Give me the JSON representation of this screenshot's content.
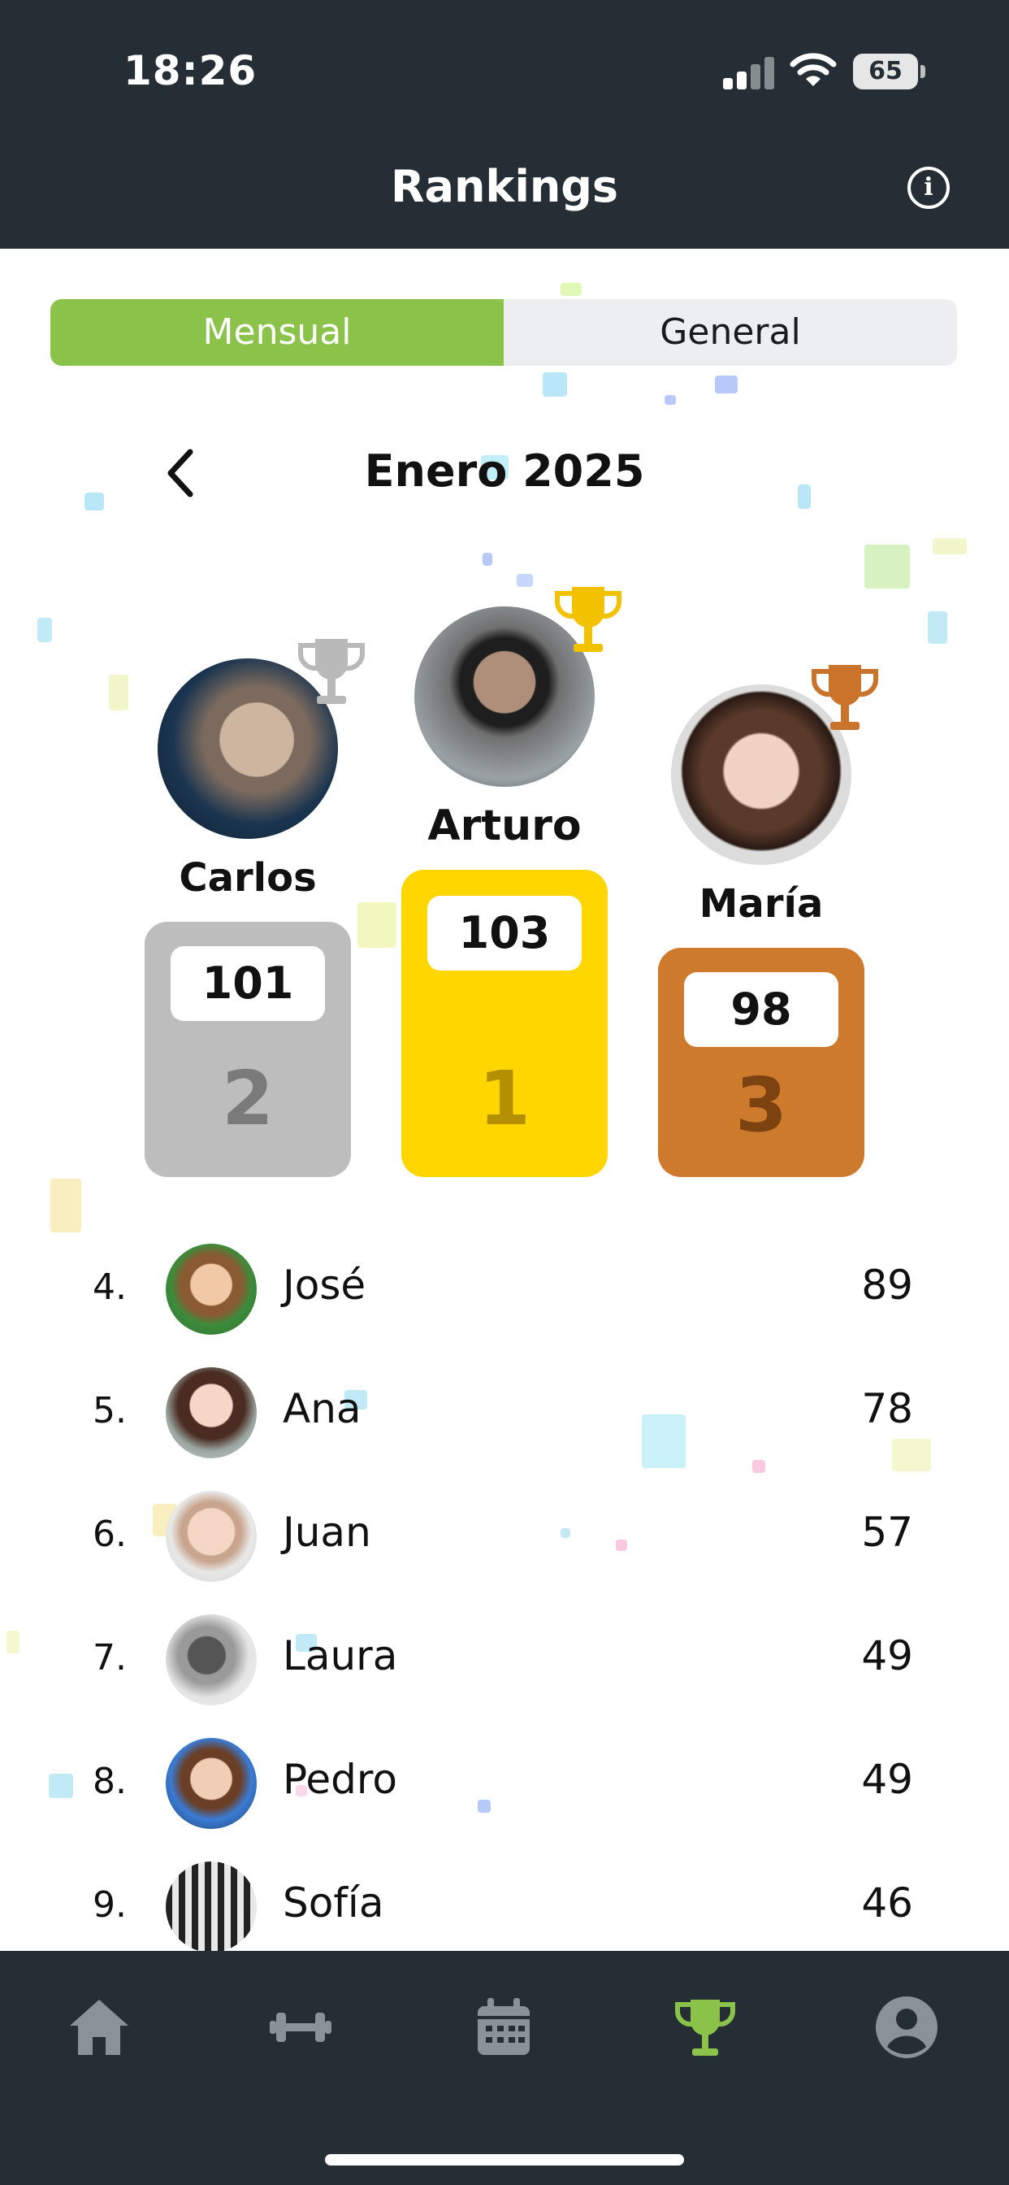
{
  "status_bar": {
    "time": "18:26",
    "battery": "65"
  },
  "header": {
    "title": "Rankings",
    "info_icon": "info-icon"
  },
  "tabs": [
    {
      "label": "Mensual",
      "active": true
    },
    {
      "label": "General",
      "active": false
    }
  ],
  "period": {
    "label": "Enero 2025",
    "back_icon": "chevron-left-icon"
  },
  "podium": {
    "first": {
      "name": "Arturo",
      "score": "103",
      "rank": "1",
      "color": "#ffd600",
      "trophy_color": "#f2c200"
    },
    "second": {
      "name": "Carlos",
      "score": "101",
      "rank": "2",
      "color": "#bdbdbd",
      "trophy_color": "#b9b9b9"
    },
    "third": {
      "name": "María",
      "score": "98",
      "rank": "3",
      "color": "#cd7a2c",
      "trophy_color": "#c9742a"
    }
  },
  "ranking_list": [
    {
      "rank": "4.",
      "name": "José",
      "score": "89"
    },
    {
      "rank": "5.",
      "name": "Ana",
      "score": "78"
    },
    {
      "rank": "6.",
      "name": "Juan",
      "score": "57"
    },
    {
      "rank": "7.",
      "name": "Laura",
      "score": "49"
    },
    {
      "rank": "8.",
      "name": "Pedro",
      "score": "49"
    },
    {
      "rank": "9.",
      "name": "Sofía",
      "score": "46"
    }
  ],
  "bottom_nav": [
    {
      "icon": "home-icon",
      "active": false
    },
    {
      "icon": "dumbbell-icon",
      "active": false
    },
    {
      "icon": "calendar-icon",
      "active": false
    },
    {
      "icon": "trophy-icon",
      "active": true
    },
    {
      "icon": "profile-icon",
      "active": false
    }
  ],
  "colors": {
    "header_bg": "#252e35",
    "accent_green": "#8bc34a",
    "nav_inactive": "#8a9198"
  }
}
